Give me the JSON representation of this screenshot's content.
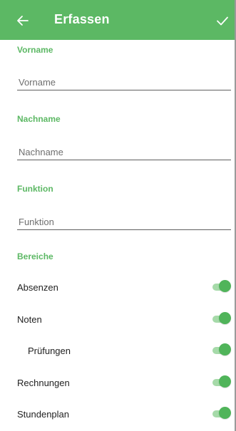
{
  "theme": {
    "accent": "#5cb864",
    "switch_track": "#a6daa9",
    "switch_thumb": "#50b45a"
  },
  "appbar": {
    "title": "Erfassen",
    "back_icon": "arrow-left-icon",
    "confirm_icon": "check-icon"
  },
  "form": {
    "vorname": {
      "label": "Vorname",
      "placeholder": "Vorname",
      "value": ""
    },
    "nachname": {
      "label": "Nachname",
      "placeholder": "Nachname",
      "value": ""
    },
    "funktion": {
      "label": "Funktion",
      "placeholder": "Funktion",
      "value": ""
    }
  },
  "bereiche": {
    "label": "Bereiche",
    "items": [
      {
        "label": "Absenzen",
        "checked": true
      },
      {
        "label": "Noten",
        "checked": true
      },
      {
        "label": "Prüfungen",
        "checked": true
      },
      {
        "label": "Rechnungen",
        "checked": true
      },
      {
        "label": "Stundenplan",
        "checked": true
      }
    ]
  }
}
